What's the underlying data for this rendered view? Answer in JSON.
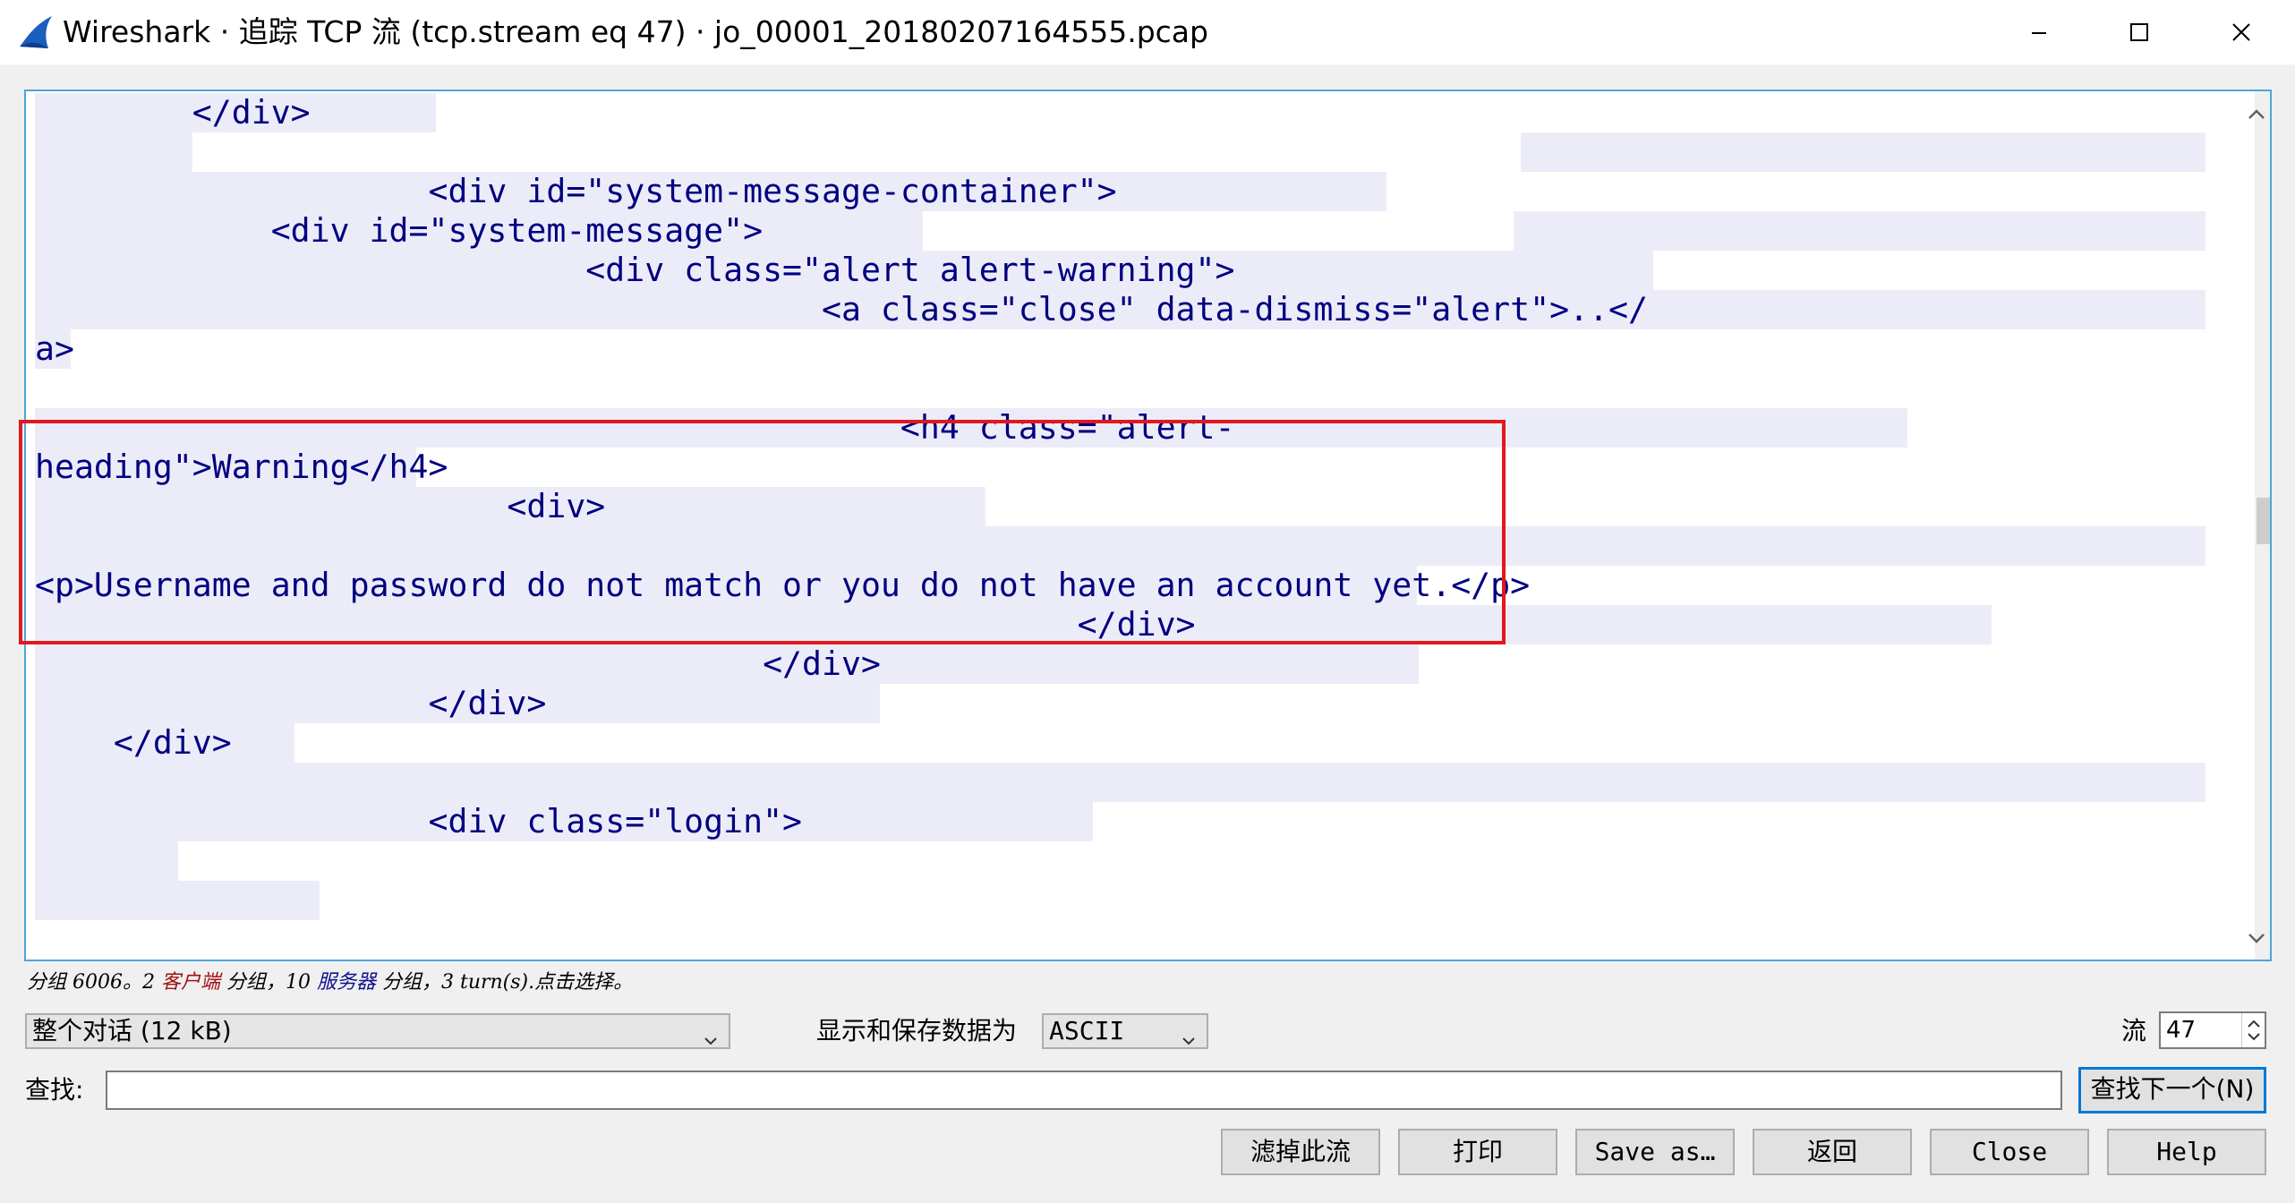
{
  "window": {
    "title": "Wireshark · 追踪 TCP 流 (tcp.stream eq 47) · jo_00001_20180207164555.pcap",
    "icon": "wireshark-fin-icon",
    "controls": [
      "minimize-icon",
      "maximize-icon",
      "close-icon"
    ]
  },
  "stream_lines": [
    "        </div>",
    "",
    "                    <div id=\"system-message-container\">",
    "            <div id=\"system-message\">",
    "                            <div class=\"alert alert-warning\">",
    "                                        <a class=\"close\" data-dismiss=\"alert\">..</",
    "a>",
    "",
    "                                            <h4 class=\"alert-",
    "heading\">Warning</h4>",
    "                        <div>",
    "",
    "<p>Username and password do not match or you do not have an account yet.</p>",
    "                                                     </div>",
    "                                     </div>",
    "                    </div>",
    "    </div>",
    "",
    "                    <div class=\"login\">",
    "",
    ""
  ],
  "status": {
    "part1": "分组 6006。2 ",
    "client": "客户端",
    "part2": " 分组，10 ",
    "server": "服务器",
    "part3": " 分组，3 turn(s).点击选择。",
    "client_color": "#a01010",
    "server_color": "#101090"
  },
  "controls": {
    "conversation": "整个对话 (12 kB)",
    "show_save_label": "显示和保存数据为",
    "format": "ASCII",
    "stream_label": "流",
    "stream_value": "47"
  },
  "find": {
    "label": "查找:",
    "value": "",
    "next_button": "查找下一个(N)"
  },
  "buttons": {
    "filter_out": "滤掉此流",
    "print": "打印",
    "save_as": "Save as…",
    "back": "返回",
    "close": "Close",
    "help": "Help"
  },
  "colors": {
    "text": "#000080",
    "highlight": "#ececf9",
    "annotation_box": "#e0191e",
    "focus": "#0078d7"
  }
}
